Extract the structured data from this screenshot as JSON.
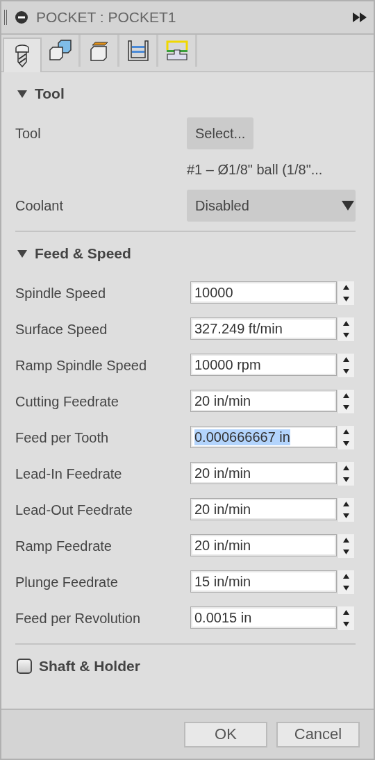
{
  "window": {
    "title": "POCKET : POCKET1"
  },
  "tabs": [
    {
      "kind": "tool",
      "selected": true
    },
    {
      "kind": "geometry",
      "selected": false
    },
    {
      "kind": "heights",
      "selected": false
    },
    {
      "kind": "passes",
      "selected": false
    },
    {
      "kind": "linking",
      "selected": false
    }
  ],
  "sections": [
    {
      "title": "Tool",
      "kind": "group",
      "expanded": true,
      "rows": [
        {
          "kind": "button",
          "label": "Tool",
          "value": "Select..."
        },
        {
          "kind": "info",
          "value": "#1 – Ø1/8\" ball (1/8\"..."
        },
        {
          "kind": "dropdown",
          "label": "Coolant",
          "value": "Disabled"
        }
      ]
    },
    {
      "title": "Feed & Speed",
      "kind": "group",
      "expanded": true,
      "rows": [
        {
          "kind": "spinner",
          "label": "Spindle Speed",
          "value": "10000",
          "highlighted": false
        },
        {
          "kind": "spinner",
          "label": "Surface Speed",
          "value": "327.249 ft/min",
          "highlighted": false
        },
        {
          "kind": "spinner",
          "label": "Ramp Spindle Speed",
          "value": "10000 rpm",
          "highlighted": false
        },
        {
          "kind": "spinner",
          "label": "Cutting Feedrate",
          "value": "20 in/min",
          "highlighted": false
        },
        {
          "kind": "spinner",
          "label": "Feed per Tooth",
          "value": "0.000666667 in",
          "highlighted": true
        },
        {
          "kind": "spinner",
          "label": "Lead-In Feedrate",
          "value": "20 in/min",
          "highlighted": false
        },
        {
          "kind": "spinner",
          "label": "Lead-Out Feedrate",
          "value": "20 in/min",
          "highlighted": false
        },
        {
          "kind": "spinner",
          "label": "Ramp Feedrate",
          "value": "20 in/min",
          "highlighted": false
        },
        {
          "kind": "spinner",
          "label": "Plunge Feedrate",
          "value": "15 in/min",
          "highlighted": false
        },
        {
          "kind": "spinner",
          "label": "Feed per Revolution",
          "value": "0.0015 in",
          "highlighted": false
        }
      ]
    },
    {
      "title": "Shaft & Holder",
      "kind": "checkbox",
      "checked": false
    }
  ],
  "buttons": [
    "OK",
    "Cancel"
  ]
}
